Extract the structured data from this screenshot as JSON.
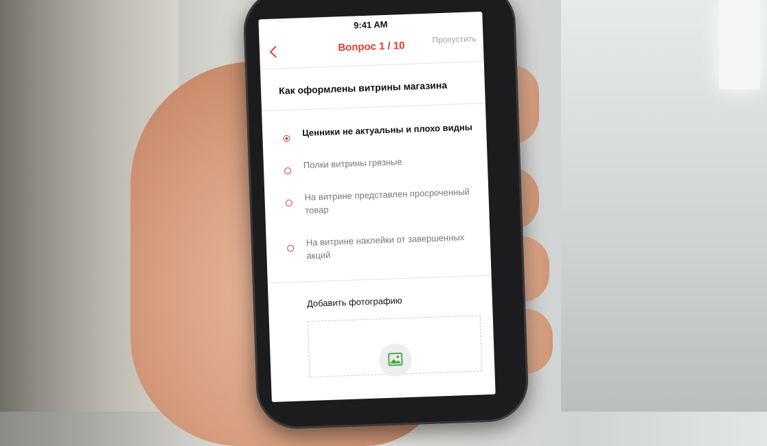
{
  "status_bar": {
    "time": "9:41 AM"
  },
  "nav": {
    "back_icon": "chevron-left-icon",
    "title": "Вопрос 1 / 10",
    "skip_label": "Пропустить",
    "accent_color": "#e8392d"
  },
  "question": {
    "text": "Как оформлены витрины магазина"
  },
  "options": [
    {
      "label": "Ценники не актуальны и плохо видны",
      "selected": true
    },
    {
      "label": "Полки витрины грязные",
      "selected": false
    },
    {
      "label": "На витрине представлен просроченный товар",
      "selected": false
    },
    {
      "label": "На витрине наклейки от завершенных акций",
      "selected": false
    }
  ],
  "photo": {
    "label": "Добавить фотографию",
    "icon": "image-icon",
    "icon_color": "#3aa53a"
  }
}
